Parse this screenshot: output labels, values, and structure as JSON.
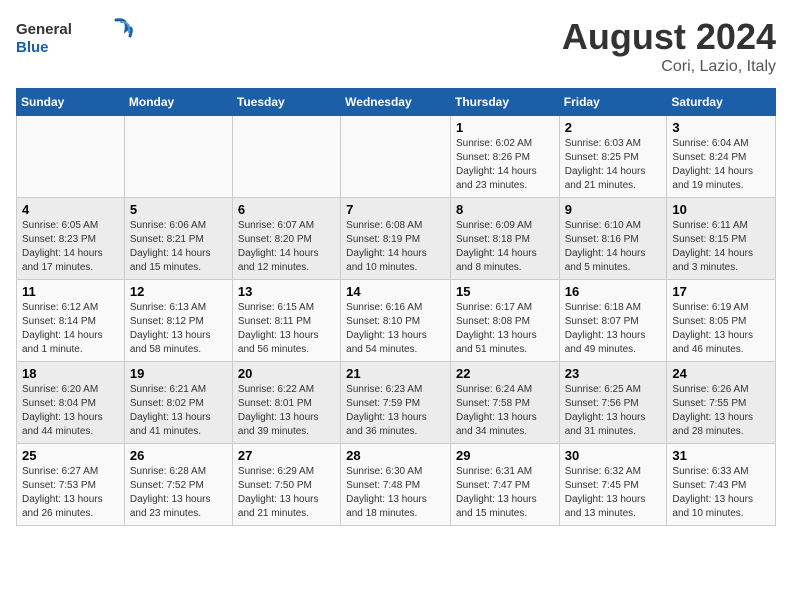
{
  "header": {
    "logo_general": "General",
    "logo_blue": "Blue",
    "title": "August 2024",
    "subtitle": "Cori, Lazio, Italy"
  },
  "weekdays": [
    "Sunday",
    "Monday",
    "Tuesday",
    "Wednesday",
    "Thursday",
    "Friday",
    "Saturday"
  ],
  "weeks": [
    [
      {
        "day": "",
        "info": ""
      },
      {
        "day": "",
        "info": ""
      },
      {
        "day": "",
        "info": ""
      },
      {
        "day": "",
        "info": ""
      },
      {
        "day": "1",
        "info": "Sunrise: 6:02 AM\nSunset: 8:26 PM\nDaylight: 14 hours and 23 minutes."
      },
      {
        "day": "2",
        "info": "Sunrise: 6:03 AM\nSunset: 8:25 PM\nDaylight: 14 hours and 21 minutes."
      },
      {
        "day": "3",
        "info": "Sunrise: 6:04 AM\nSunset: 8:24 PM\nDaylight: 14 hours and 19 minutes."
      }
    ],
    [
      {
        "day": "4",
        "info": "Sunrise: 6:05 AM\nSunset: 8:23 PM\nDaylight: 14 hours and 17 minutes."
      },
      {
        "day": "5",
        "info": "Sunrise: 6:06 AM\nSunset: 8:21 PM\nDaylight: 14 hours and 15 minutes."
      },
      {
        "day": "6",
        "info": "Sunrise: 6:07 AM\nSunset: 8:20 PM\nDaylight: 14 hours and 12 minutes."
      },
      {
        "day": "7",
        "info": "Sunrise: 6:08 AM\nSunset: 8:19 PM\nDaylight: 14 hours and 10 minutes."
      },
      {
        "day": "8",
        "info": "Sunrise: 6:09 AM\nSunset: 8:18 PM\nDaylight: 14 hours and 8 minutes."
      },
      {
        "day": "9",
        "info": "Sunrise: 6:10 AM\nSunset: 8:16 PM\nDaylight: 14 hours and 5 minutes."
      },
      {
        "day": "10",
        "info": "Sunrise: 6:11 AM\nSunset: 8:15 PM\nDaylight: 14 hours and 3 minutes."
      }
    ],
    [
      {
        "day": "11",
        "info": "Sunrise: 6:12 AM\nSunset: 8:14 PM\nDaylight: 14 hours and 1 minute."
      },
      {
        "day": "12",
        "info": "Sunrise: 6:13 AM\nSunset: 8:12 PM\nDaylight: 13 hours and 58 minutes."
      },
      {
        "day": "13",
        "info": "Sunrise: 6:15 AM\nSunset: 8:11 PM\nDaylight: 13 hours and 56 minutes."
      },
      {
        "day": "14",
        "info": "Sunrise: 6:16 AM\nSunset: 8:10 PM\nDaylight: 13 hours and 54 minutes."
      },
      {
        "day": "15",
        "info": "Sunrise: 6:17 AM\nSunset: 8:08 PM\nDaylight: 13 hours and 51 minutes."
      },
      {
        "day": "16",
        "info": "Sunrise: 6:18 AM\nSunset: 8:07 PM\nDaylight: 13 hours and 49 minutes."
      },
      {
        "day": "17",
        "info": "Sunrise: 6:19 AM\nSunset: 8:05 PM\nDaylight: 13 hours and 46 minutes."
      }
    ],
    [
      {
        "day": "18",
        "info": "Sunrise: 6:20 AM\nSunset: 8:04 PM\nDaylight: 13 hours and 44 minutes."
      },
      {
        "day": "19",
        "info": "Sunrise: 6:21 AM\nSunset: 8:02 PM\nDaylight: 13 hours and 41 minutes."
      },
      {
        "day": "20",
        "info": "Sunrise: 6:22 AM\nSunset: 8:01 PM\nDaylight: 13 hours and 39 minutes."
      },
      {
        "day": "21",
        "info": "Sunrise: 6:23 AM\nSunset: 7:59 PM\nDaylight: 13 hours and 36 minutes."
      },
      {
        "day": "22",
        "info": "Sunrise: 6:24 AM\nSunset: 7:58 PM\nDaylight: 13 hours and 34 minutes."
      },
      {
        "day": "23",
        "info": "Sunrise: 6:25 AM\nSunset: 7:56 PM\nDaylight: 13 hours and 31 minutes."
      },
      {
        "day": "24",
        "info": "Sunrise: 6:26 AM\nSunset: 7:55 PM\nDaylight: 13 hours and 28 minutes."
      }
    ],
    [
      {
        "day": "25",
        "info": "Sunrise: 6:27 AM\nSunset: 7:53 PM\nDaylight: 13 hours and 26 minutes."
      },
      {
        "day": "26",
        "info": "Sunrise: 6:28 AM\nSunset: 7:52 PM\nDaylight: 13 hours and 23 minutes."
      },
      {
        "day": "27",
        "info": "Sunrise: 6:29 AM\nSunset: 7:50 PM\nDaylight: 13 hours and 21 minutes."
      },
      {
        "day": "28",
        "info": "Sunrise: 6:30 AM\nSunset: 7:48 PM\nDaylight: 13 hours and 18 minutes."
      },
      {
        "day": "29",
        "info": "Sunrise: 6:31 AM\nSunset: 7:47 PM\nDaylight: 13 hours and 15 minutes."
      },
      {
        "day": "30",
        "info": "Sunrise: 6:32 AM\nSunset: 7:45 PM\nDaylight: 13 hours and 13 minutes."
      },
      {
        "day": "31",
        "info": "Sunrise: 6:33 AM\nSunset: 7:43 PM\nDaylight: 13 hours and 10 minutes."
      }
    ]
  ]
}
